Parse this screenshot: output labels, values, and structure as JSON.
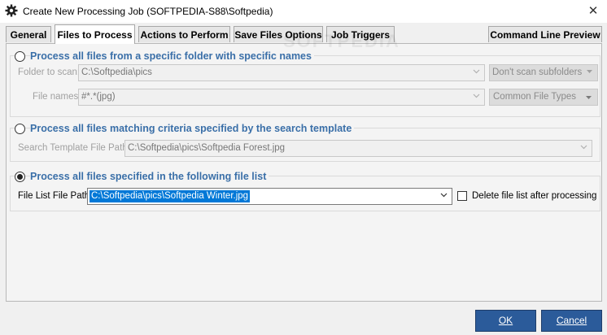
{
  "window": {
    "title": "Create New Processing Job (SOFTPEDIA-S88\\Softpedia)",
    "close_glyph": "✕"
  },
  "tabs": [
    {
      "label": "General"
    },
    {
      "label": "Files to Process"
    },
    {
      "label": "Actions to Perform"
    },
    {
      "label": "Save Files Options"
    },
    {
      "label": "Job Triggers"
    },
    {
      "label": "Command Line Preview"
    }
  ],
  "active_tab": "Files to Process",
  "watermark": "SOFTPEDIA",
  "section_folder": {
    "title": "Process all files from a specific folder with specific names",
    "selected": false,
    "folder_label": "Folder to scan:",
    "folder_value": "C:\\Softpedia\\pics",
    "subfolder_option": "Don't scan subfolders",
    "names_label": "File names:",
    "names_value": "#*.*(jpg)",
    "file_types_button": "Common File Types"
  },
  "section_template": {
    "title": "Process all files matching criteria specified by the search template",
    "selected": false,
    "path_label": "Search Template File Path:",
    "path_value": "C:\\Softpedia\\pics\\Softpedia Forest.jpg"
  },
  "section_list": {
    "title": "Process all files specified in the following file list",
    "selected": true,
    "path_label": "File List File Path:",
    "path_value": "C:\\Softpedia\\pics\\Softpedia Winter.jpg",
    "delete_label": "Delete file list after processing",
    "delete_checked": false
  },
  "buttons": {
    "ok": "OK",
    "cancel": "Cancel"
  },
  "colors": {
    "accent": "#3a6fa8",
    "button": "#2b5b9a",
    "selection": "#0078d7"
  }
}
